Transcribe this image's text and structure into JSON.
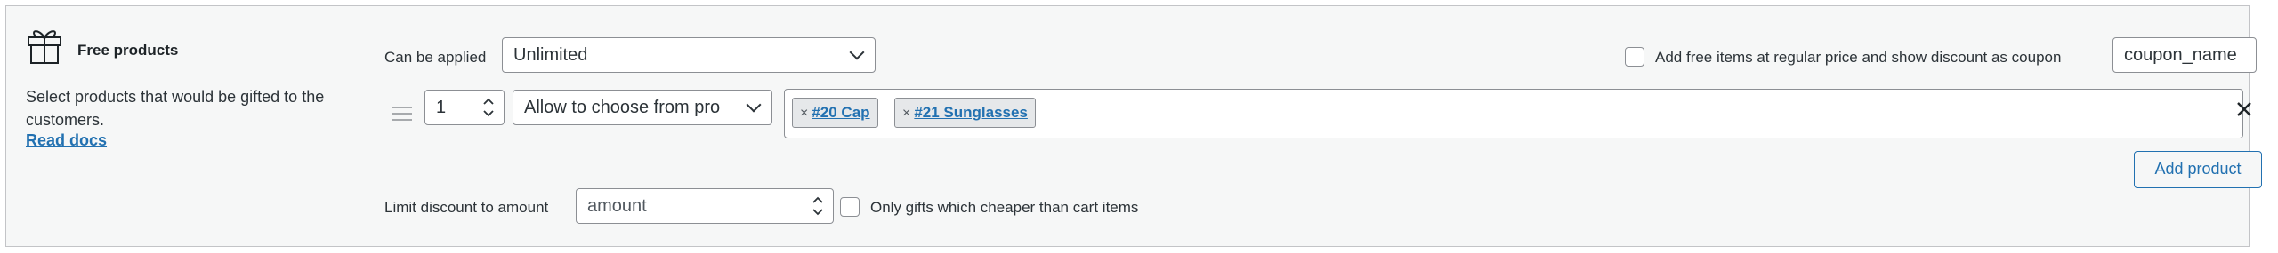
{
  "section": {
    "title": "Free products",
    "description": "Select products that would be gifted to the customers.",
    "read_docs": "Read docs"
  },
  "can_be_applied": {
    "label": "Can be applied",
    "value": "Unlimited"
  },
  "coupon_option": {
    "label": "Add free items at regular price and show discount as coupon",
    "checked": false,
    "input_value": "coupon_name"
  },
  "product_row": {
    "quantity": "1",
    "mode": "Allow to choose from pro",
    "tags": [
      {
        "remove": "×",
        "label": "#20 Cap"
      },
      {
        "remove": "×",
        "label": "#21 Sunglasses"
      }
    ],
    "remove_icon": "×"
  },
  "add_product_button": "Add product",
  "limit_discount": {
    "label": "Limit discount to amount",
    "placeholder": "amount"
  },
  "only_gifts": {
    "label": "Only gifts which cheaper than cart items",
    "checked": false
  },
  "colors": {
    "accent": "#2271b1",
    "panel_bg": "#f6f7f7",
    "border": "#8c8f94"
  }
}
